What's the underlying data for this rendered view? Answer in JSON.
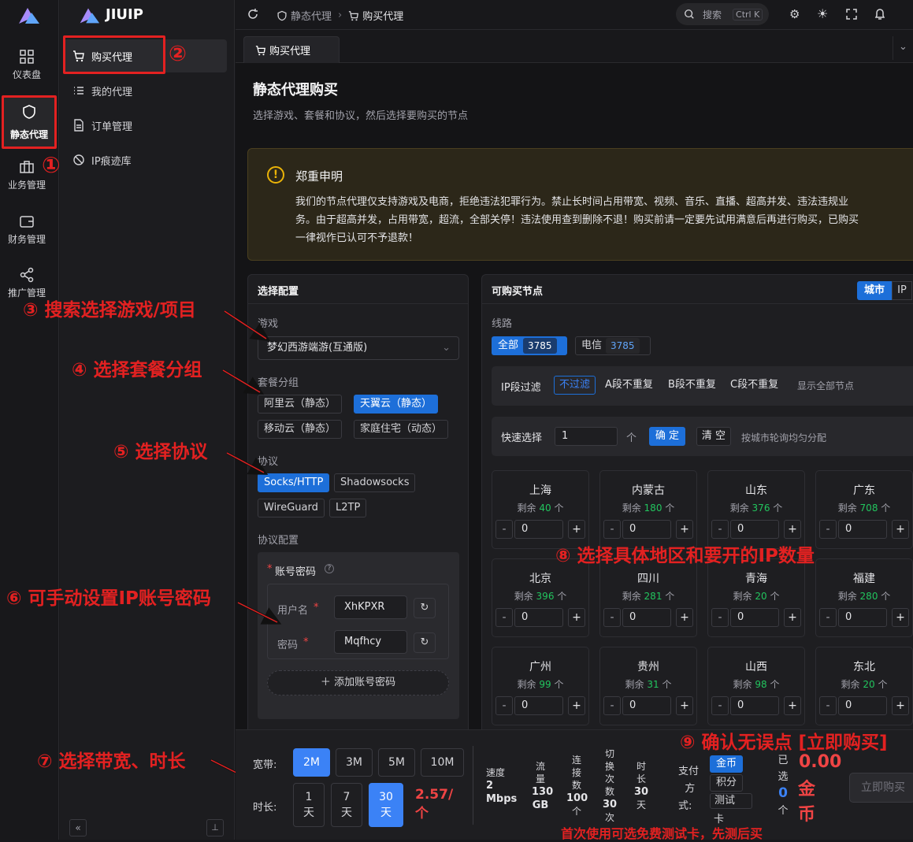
{
  "app": {
    "name": "JIUIP"
  },
  "rail": [
    {
      "label": "仪表盘",
      "icon": "dashboard-icon"
    },
    {
      "label": "静态代理",
      "icon": "shield-icon"
    },
    {
      "label": "业务管理",
      "icon": "briefcase-icon"
    },
    {
      "label": "财务管理",
      "icon": "wallet-icon"
    },
    {
      "label": "推广管理",
      "icon": "share-icon"
    }
  ],
  "menu": [
    {
      "label": "购买代理",
      "icon": "cart-icon"
    },
    {
      "label": "我的代理",
      "icon": "list-icon"
    },
    {
      "label": "订单管理",
      "icon": "document-icon"
    },
    {
      "label": "IP痕迹库",
      "icon": "ban-icon"
    }
  ],
  "topbar": {
    "crumb1": "静态代理",
    "crumb2": "购买代理",
    "search": "搜索",
    "shortcut": "Ctrl K"
  },
  "tab": {
    "label": "购买代理"
  },
  "page": {
    "title": "静态代理购买",
    "subtitle": "选择游戏、套餐和协议，然后选择要购买的节点"
  },
  "notice": {
    "title": "郑重申明",
    "line1": "我们的节点代理仅支持游戏及电商，拒绝违法犯罪行为。禁止长时间占用带宽、视频、音乐、直播、超高并发、违法违规业",
    "line2": "务。由于超高并发，占用带宽，超流，全部关停！违法使用查到删除不退！购买前请一定要先试用满意后再进行购买，已购买",
    "line3": "一律视作已认可不予退款！"
  },
  "config": {
    "title": "选择配置",
    "game_label": "游戏",
    "game_value": "梦幻西游端游(互通版)",
    "pkg_label": "套餐分组",
    "pkgs": [
      "阿里云（静态）",
      "天翼云（静态）",
      "移动云（静态）",
      "家庭住宅（动态）"
    ],
    "proto_label": "协议",
    "protos": [
      "Socks/HTTP",
      "Shadowsocks",
      "WireGuard",
      "L2TP"
    ],
    "proto_cfg_label": "协议配置",
    "account_label": "账号密码",
    "required": "*",
    "username_label": "用户名",
    "username": "XhKPXR",
    "password_label": "密码",
    "password": "Mqfhcy",
    "add_account": "添加账号密码"
  },
  "nodes": {
    "title": "可购买节点",
    "toggle": [
      "城市",
      "IP"
    ],
    "line_label": "线路",
    "lines": [
      {
        "name": "全部",
        "count": "3785"
      },
      {
        "name": "电信",
        "count": "3785"
      }
    ],
    "ipfilter_label": "IP段过滤",
    "ipfilters": [
      "不过滤",
      "A段不重复",
      "B段不重复",
      "C段不重复"
    ],
    "show_all": "显示全部节点",
    "quick_label": "快速选择",
    "quick_value": "1",
    "unit": "个",
    "confirm": "确 定",
    "clear": "清 空",
    "quick_hint": "按城市轮询均匀分配",
    "remain_prefix": "剩余",
    "remain_suffix": "个",
    "cities": [
      {
        "name": "上海",
        "remain": "40",
        "value": "0"
      },
      {
        "name": "内蒙古",
        "remain": "180",
        "value": "0"
      },
      {
        "name": "山东",
        "remain": "376",
        "value": "0"
      },
      {
        "name": "广东",
        "remain": "708",
        "value": "0"
      },
      {
        "name": "北京",
        "remain": "396",
        "value": "0"
      },
      {
        "name": "四川",
        "remain": "281",
        "value": "0"
      },
      {
        "name": "青海",
        "remain": "20",
        "value": "0"
      },
      {
        "name": "福建",
        "remain": "280",
        "value": "0"
      },
      {
        "name": "广州",
        "remain": "99",
        "value": "0"
      },
      {
        "name": "贵州",
        "remain": "31",
        "value": "0"
      },
      {
        "name": "山西",
        "remain": "98",
        "value": "0"
      },
      {
        "name": "东北",
        "remain": "20",
        "value": "0"
      }
    ]
  },
  "bottom": {
    "bw_label": "宽带:",
    "bws": [
      "2M",
      "3M",
      "5M",
      "10M"
    ],
    "dur_label": "时长:",
    "durs": [
      [
        "1",
        "天"
      ],
      [
        "7",
        "天"
      ],
      [
        "30",
        "天"
      ]
    ],
    "price": "2.57/",
    "price_unit": "个",
    "speed_label": "速度",
    "speed_value": "2",
    "speed_unit": "Mbps",
    "flow_label": [
      "流",
      "量"
    ],
    "flow_value": "130",
    "flow_unit": "GB",
    "conn_label": [
      "连",
      "接",
      "数"
    ],
    "conn_value": "100",
    "conn_unit": "个",
    "switch_label": [
      "切",
      "换",
      "次",
      "数"
    ],
    "switch_value": "30",
    "switch_unit": "次",
    "time_label": [
      "时",
      "长"
    ],
    "time_value": "30",
    "time_unit": "天",
    "pay_label": [
      "支付",
      "方",
      "式:"
    ],
    "pays": [
      "金币",
      "积分",
      "测试",
      "卡"
    ],
    "selected_label": [
      "已",
      "选"
    ],
    "selected_value": "0",
    "selected_unit": "个",
    "total": "0.00",
    "total_unit": [
      "金",
      "币"
    ],
    "buy": "立即购买"
  },
  "annotations": [
    "①",
    "②",
    "③ 搜索选择游戏/项目",
    "④ 选择套餐分组",
    "⑤ 选择协议",
    "⑥ 可手动设置IP账号密码",
    "⑦ 选择带宽、时长",
    "⑧ 选择具体地区和要开的IP数量",
    "⑨ 确认无误点 [立即购买]",
    "首次使用可选免费测试卡，先测后买"
  ],
  "colors": {
    "accent": "#1d6fd9",
    "annotation": "#e32121",
    "green": "#22c55e",
    "price": "#ef4444"
  }
}
